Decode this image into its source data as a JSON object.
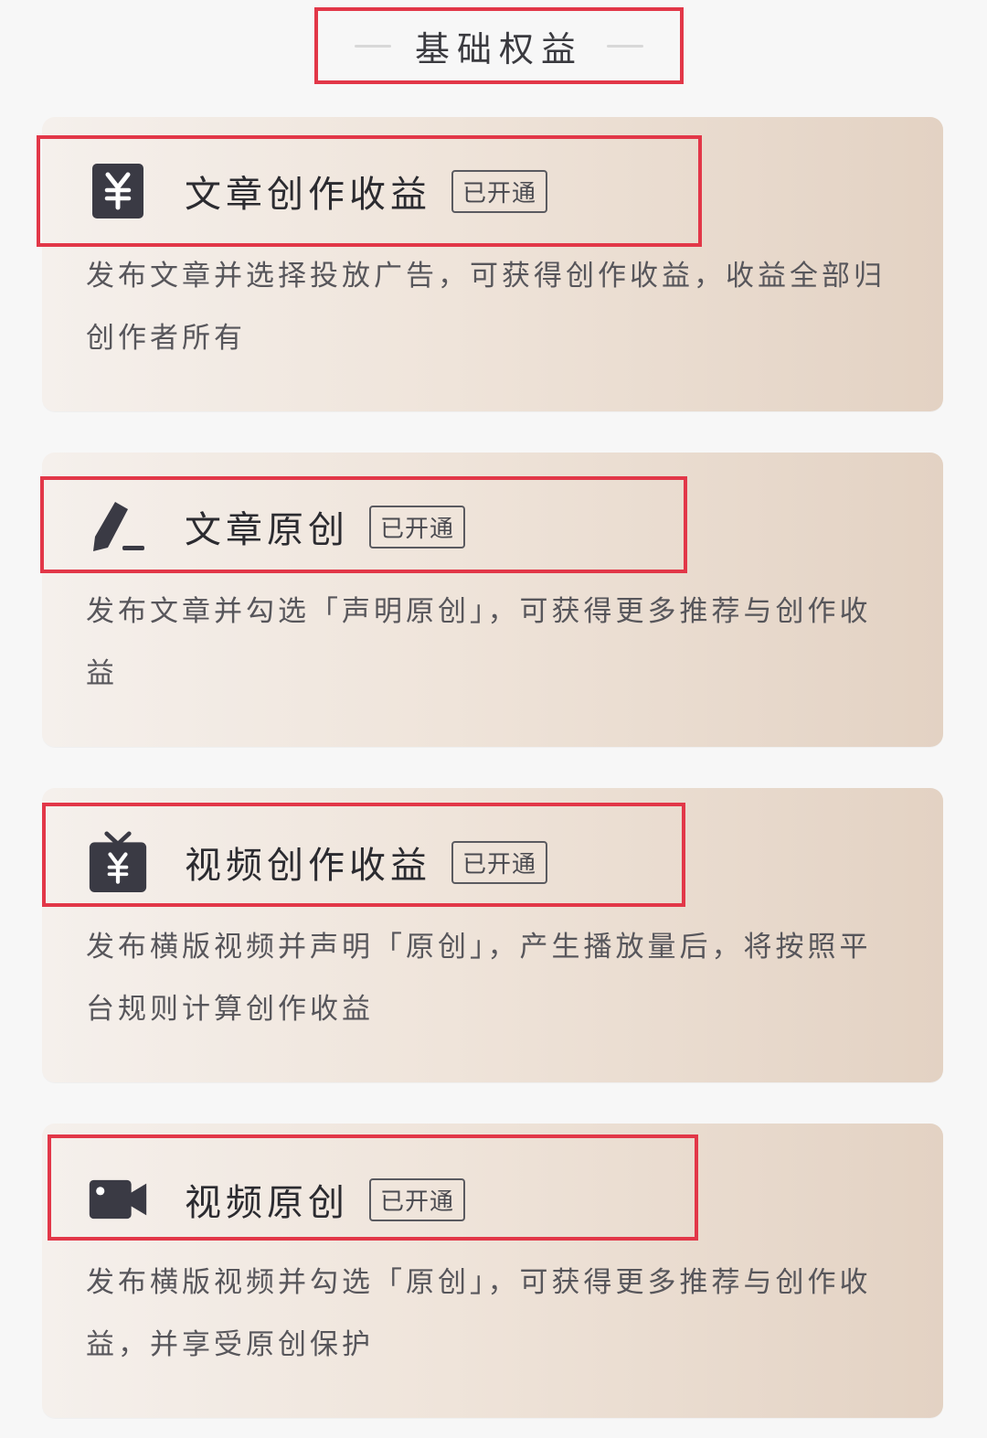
{
  "section": {
    "title": "基础权益"
  },
  "cards": [
    {
      "icon": "yuan-square-icon",
      "title": "文章创作收益",
      "badge": "已开通",
      "description": "发布文章并选择投放广告，可获得创作收益，收益全部归创作者所有"
    },
    {
      "icon": "pen-icon",
      "title": "文章原创",
      "badge": "已开通",
      "description": "发布文章并勾选「声明原创」，可获得更多推荐与创作收益"
    },
    {
      "icon": "tv-yuan-icon",
      "title": "视频创作收益",
      "badge": "已开通",
      "description": "发布横版视频并声明「原创」，产生播放量后，将按照平台规则计算创作收益"
    },
    {
      "icon": "video-camera-icon",
      "title": "视频原创",
      "badge": "已开通",
      "description": "发布横版视频并勾选「原创」，可获得更多推荐与创作收益，并享受原创保护"
    }
  ],
  "colors": {
    "highlight": "#e23748",
    "icon": "#3a3a44"
  }
}
